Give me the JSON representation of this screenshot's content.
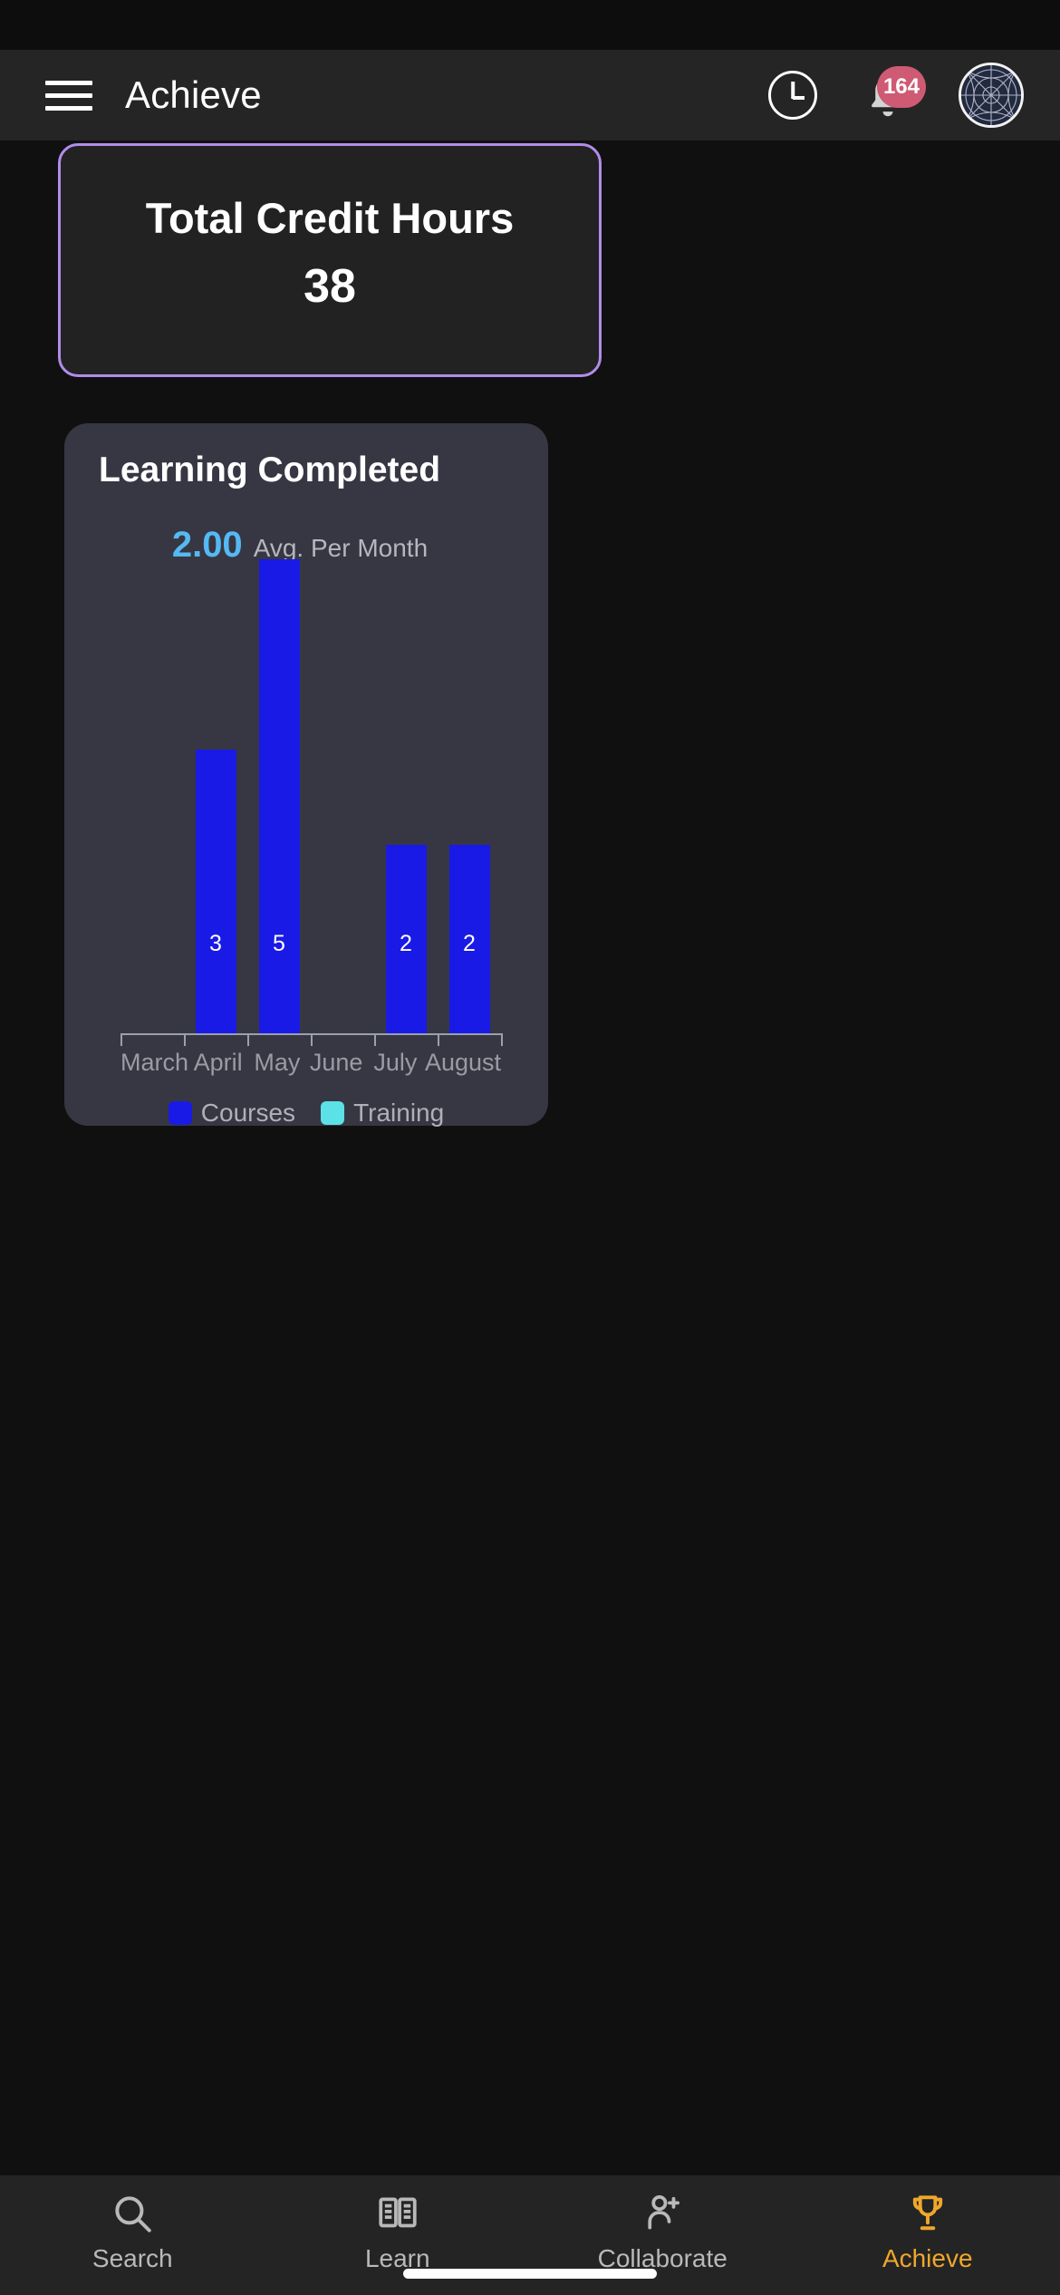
{
  "appbar": {
    "menu_icon": "hamburger-menu-icon",
    "title": "Achieve",
    "clock_icon": "clock-icon",
    "bell_icon": "bell-icon",
    "notification_count": "164",
    "avatar_icon": "user-avatar"
  },
  "credit_card": {
    "title": "Total Credit Hours",
    "value": "38",
    "border_color": "#b28ceb"
  },
  "chart_card": {
    "title": "Learning Completed",
    "stat_value": "2.00",
    "stat_label": "Avg. Per Month"
  },
  "chart_data": {
    "type": "bar",
    "title": "Learning Completed",
    "categories": [
      "March",
      "April",
      "May",
      "June",
      "July",
      "August"
    ],
    "series": [
      {
        "name": "Courses",
        "color": "#1a1ae6",
        "values": [
          0,
          3,
          5,
          0,
          2,
          2
        ]
      },
      {
        "name": "Training",
        "color": "#5ce1e6",
        "values": [
          0,
          0,
          0,
          0,
          0,
          0
        ]
      }
    ],
    "value_labels": [
      "",
      "3",
      "5",
      "",
      "2",
      "2"
    ],
    "xlabel": "",
    "ylabel": "",
    "ylim": [
      0,
      5
    ],
    "grid": false,
    "legend_position": "bottom"
  },
  "legend": [
    {
      "label": "Courses",
      "color": "#1a1ae6"
    },
    {
      "label": "Training",
      "color": "#5ce1e6"
    }
  ],
  "bottomnav": {
    "items": [
      {
        "label": "Search",
        "icon": "search-icon",
        "active": false
      },
      {
        "label": "Learn",
        "icon": "book-icon",
        "active": false
      },
      {
        "label": "Collaborate",
        "icon": "person-add-icon",
        "active": false
      },
      {
        "label": "Achieve",
        "icon": "trophy-icon",
        "active": true
      }
    ],
    "active_color": "#efa72c"
  }
}
